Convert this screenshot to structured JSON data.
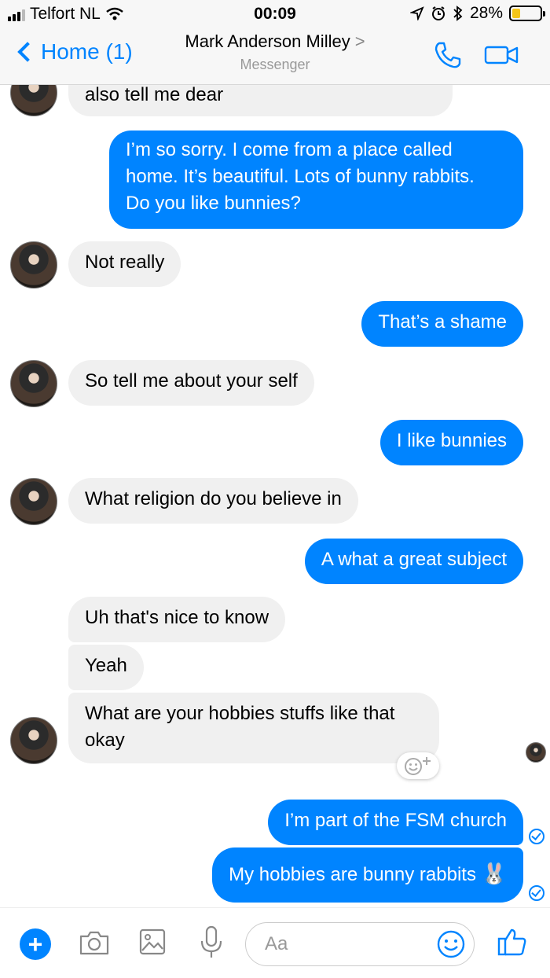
{
  "status": {
    "carrier": "Telfort NL",
    "time": "00:09",
    "battery": "28%",
    "battery_level": 0.28
  },
  "header": {
    "back_label": "Home (1)",
    "contact_name": "Mark Anderson Milley",
    "chevron": ">",
    "subtitle": "Messenger"
  },
  "messages": [
    {
      "from": "them",
      "lines": [
        "also tell me dear"
      ]
    },
    {
      "from": "me",
      "lines": [
        "I’m so sorry. I come from a place called",
        "home. It’s beautiful. Lots of bunny rabbits.",
        "Do you like bunnies?"
      ]
    },
    {
      "from": "them",
      "lines": [
        "Not really"
      ]
    },
    {
      "from": "me",
      "lines": [
        "That’s a shame"
      ]
    },
    {
      "from": "them",
      "lines": [
        "So tell me about your self"
      ]
    },
    {
      "from": "me",
      "lines": [
        "I like bunnies"
      ]
    },
    {
      "from": "them",
      "lines": [
        "What religion do you believe in"
      ]
    },
    {
      "from": "me",
      "lines": [
        "A what a great subject"
      ]
    },
    {
      "from": "them",
      "lines": [
        "Uh that's nice to know"
      ]
    },
    {
      "from": "them",
      "lines": [
        "Yeah"
      ]
    },
    {
      "from": "them",
      "lines": [
        "What are your hobbies stuffs like that",
        "okay"
      ]
    },
    {
      "from": "me",
      "lines": [
        "I’m part of the FSM church"
      ]
    },
    {
      "from": "me",
      "lines": [
        "My hobbies are bunny rabbits"
      ],
      "emoji": "🐰"
    }
  ],
  "composer": {
    "placeholder": "Aa"
  },
  "colors": {
    "accent": "#0084ff",
    "incoming_bubble": "#f0f0f0",
    "battery": "#f5c518"
  },
  "icons": [
    "signal-icon",
    "wifi-icon",
    "location-icon",
    "alarm-icon",
    "bluetooth-icon",
    "battery-icon",
    "phone-icon",
    "video-icon",
    "plus-icon",
    "camera-icon",
    "image-icon",
    "microphone-icon",
    "emoji-icon",
    "thumbs-up-icon",
    "add-reaction-icon",
    "read-receipt-icon"
  ]
}
